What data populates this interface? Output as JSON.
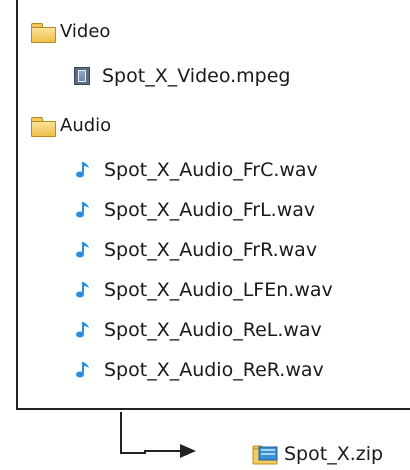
{
  "tree": {
    "folders": [
      {
        "name": "Video",
        "icon": "folder-icon",
        "files": [
          {
            "name": "Spot_X_Video.mpeg",
            "icon": "video-file-icon"
          }
        ]
      },
      {
        "name": "Audio",
        "icon": "folder-icon",
        "files": [
          {
            "name": "Spot_X_Audio_FrC.wav",
            "icon": "audio-file-icon"
          },
          {
            "name": "Spot_X_Audio_FrL.wav",
            "icon": "audio-file-icon"
          },
          {
            "name": "Spot_X_Audio_FrR.wav",
            "icon": "audio-file-icon"
          },
          {
            "name": "Spot_X_Audio_LFEn.wav",
            "icon": "audio-file-icon"
          },
          {
            "name": "Spot_X_Audio_ReL.wav",
            "icon": "audio-file-icon"
          },
          {
            "name": "Spot_X_Audio_ReR.wav",
            "icon": "audio-file-icon"
          }
        ]
      }
    ]
  },
  "output": {
    "name": "Spot_X.zip",
    "icon": "zip-archive-icon"
  },
  "colors": {
    "folder": "#f3c85a",
    "audio_note": "#2a8fe0",
    "line": "#222222"
  }
}
